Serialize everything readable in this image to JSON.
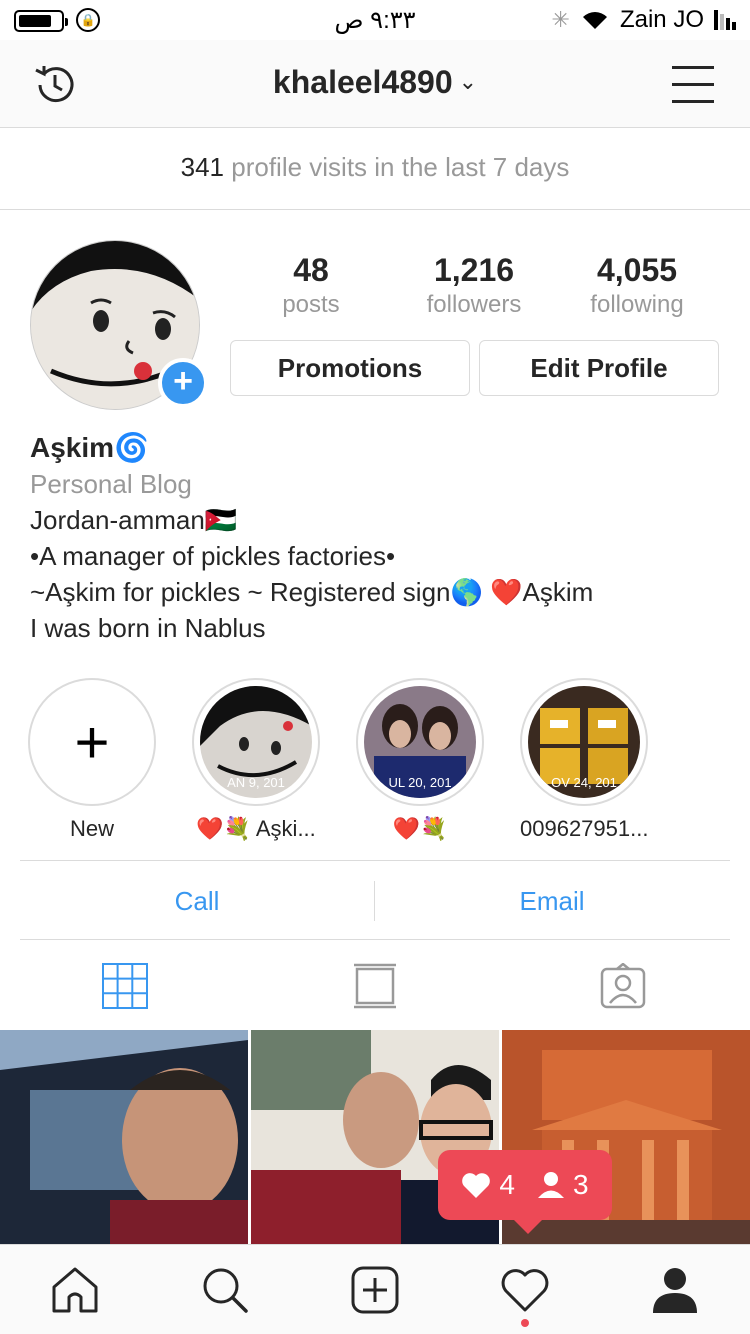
{
  "status_bar": {
    "time": "٩:٣٣ ص",
    "carrier": "Zain JO"
  },
  "nav": {
    "username": "khaleel4890",
    "chevron": "⌄"
  },
  "insights": {
    "visits_count": "341",
    "visits_text": "profile visits in the last 7 days"
  },
  "profile": {
    "add_badge": "+",
    "stats": {
      "posts_value": "48",
      "posts_label": "posts",
      "followers_value": "1,216",
      "followers_label": "followers",
      "following_value": "4,055",
      "following_label": "following"
    },
    "buttons": {
      "promotions": "Promotions",
      "edit_profile": "Edit Profile"
    },
    "bio": {
      "name": "Aşkim🌀",
      "category": "Personal Blog",
      "line1": "Jordan-amman🇯🇴",
      "line2": "•A manager of pickles factories•",
      "line3": "~Aşkim for pickles ~ Registered sign🌎  ❤️Aşkim",
      "line4": "I was born in Nablus"
    }
  },
  "highlights": [
    {
      "label": "New",
      "symbol": "+",
      "date": ""
    },
    {
      "label": "❤️💐 Aşki...",
      "date": "AN 9, 201"
    },
    {
      "label": "❤️💐",
      "date": "UL 20, 201"
    },
    {
      "label": "009627951...",
      "date": "OV 24, 201"
    }
  ],
  "contact": {
    "call": "Call",
    "email": "Email"
  },
  "tabs": {
    "active": "grid-icon",
    "icons": [
      "grid-icon",
      "feed-icon",
      "tagged-icon"
    ],
    "accent": "#3897f0"
  },
  "notification": {
    "likes": "4",
    "follows": "3",
    "color": "#ed4956"
  },
  "bottom_nav": {
    "icons": [
      "home-icon",
      "search-icon",
      "add-post-icon",
      "activity-icon",
      "profile-icon"
    ]
  }
}
